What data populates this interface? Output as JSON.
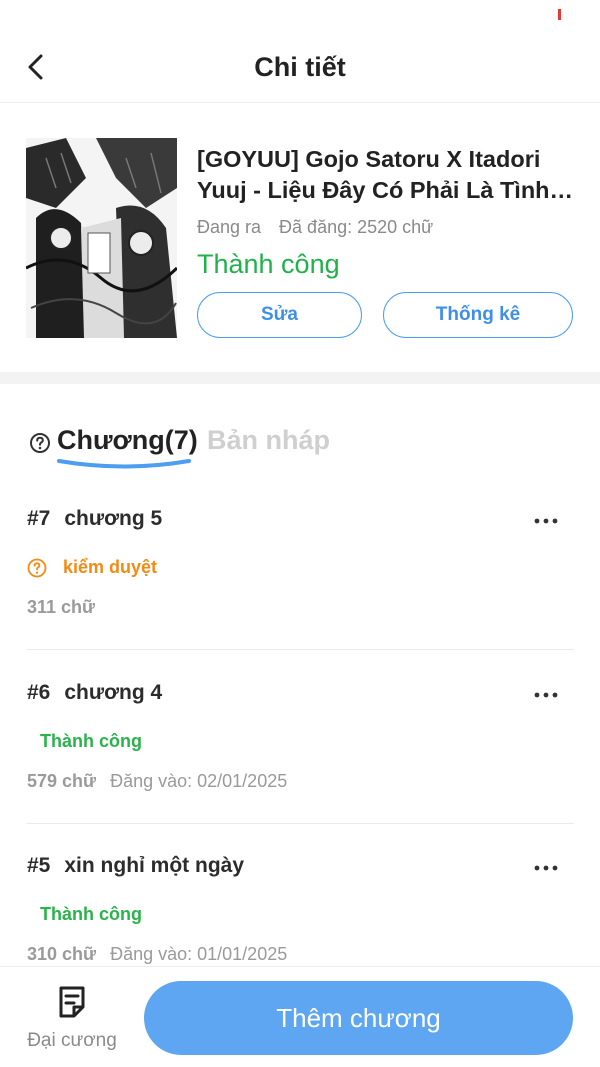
{
  "colors": {
    "accent": "#4d9df0",
    "success": "#21b14a",
    "warning": "#f28a14",
    "primary_button": "#5ea6f2"
  },
  "header": {
    "title": "Chi tiết",
    "back_icon": "chevron-left-icon"
  },
  "story": {
    "title": "[GOYUU] Gojo Satoru X Itadori Yuuj - Liệu Đây Có Phải Là Tình Yêu",
    "ongoing": "Đang ra",
    "word_count": "Đã đăng: 2520 chữ",
    "status": "Thành công",
    "edit_label": "Sửa",
    "stats_label": "Thống kê"
  },
  "tabs": {
    "chapters": "Chương(7)",
    "drafts": "Bản nháp"
  },
  "chapters": [
    {
      "num": "#7",
      "title": "chương 5",
      "status": "kiểm duyệt",
      "words": "311 chữ",
      "posted": ""
    },
    {
      "num": "#6",
      "title": "chương 4",
      "status": "Thành công",
      "words": "579 chữ",
      "posted": "Đăng vào:  02/01/2025"
    },
    {
      "num": "#5",
      "title": "xin nghỉ một ngày",
      "status": "Thành công",
      "words": "310 chữ",
      "posted": "Đăng vào:  01/01/2025"
    }
  ],
  "bottom": {
    "outline_label": "Đại cương",
    "add_chapter": "Thêm chương"
  }
}
